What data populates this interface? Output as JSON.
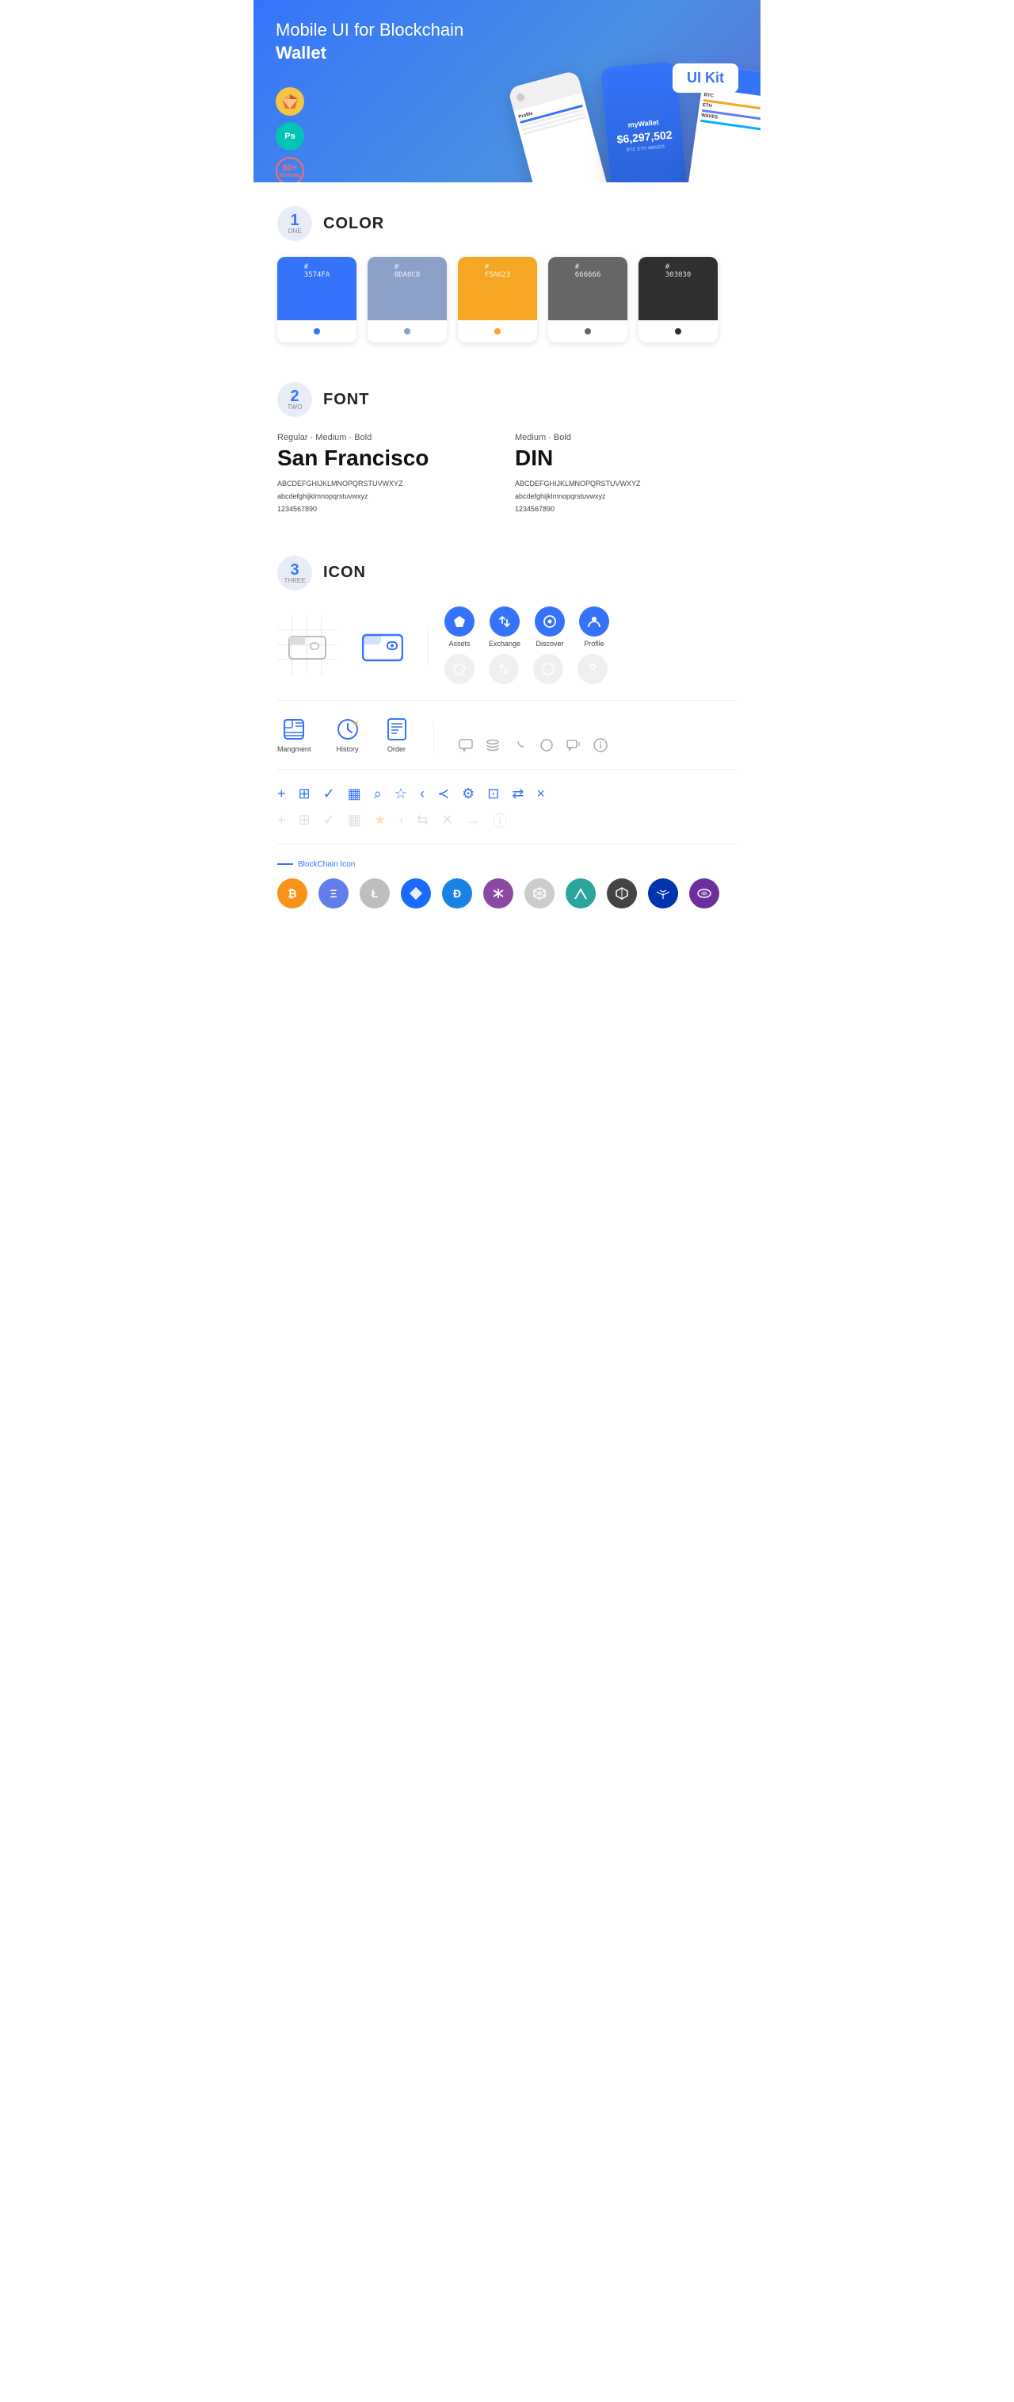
{
  "hero": {
    "title_regular": "Mobile UI for Blockchain ",
    "title_bold": "Wallet",
    "badge": "UI Kit",
    "badge_sketch": "◆",
    "badge_ps": "Ps",
    "screens_count": "60+",
    "screens_label": "Screens"
  },
  "sections": {
    "color": {
      "num": "1",
      "sub": "ONE",
      "label": "COLOR",
      "swatches": [
        {
          "hex": "#3574FA",
          "code": "#\n3574FA"
        },
        {
          "hex": "#8DA0C8",
          "code": "#\n8DA0C8"
        },
        {
          "hex": "#F5A623",
          "code": "#\nF5A623"
        },
        {
          "hex": "#666666",
          "code": "#\n666666"
        },
        {
          "hex": "#303030",
          "code": "#\n303030"
        }
      ]
    },
    "font": {
      "num": "2",
      "sub": "TWO",
      "label": "FONT",
      "left": {
        "style": "Regular · Medium · Bold",
        "name": "San Francisco",
        "upper": "ABCDEFGHIJKLMNOPQRSTUVWXYZ",
        "lower": "abcdefghijklmnopqrstuvwxyz",
        "nums": "1234567890"
      },
      "right": {
        "style": "Medium · Bold",
        "name": "DIN",
        "upper": "ABCDEFGHIJKLMNOPQRSTUVWXYZ",
        "lower": "abcdefghijklmnopqrstuvwxyz",
        "nums": "1234567890"
      }
    },
    "icon": {
      "num": "3",
      "sub": "THREE",
      "label": "ICON",
      "nav_items": [
        {
          "label": "Assets",
          "filled": true
        },
        {
          "label": "Exchange",
          "filled": true
        },
        {
          "label": "Discover",
          "filled": true
        },
        {
          "label": "Profile",
          "filled": true
        }
      ],
      "nav_ghost": [
        {
          "label": "",
          "filled": false
        },
        {
          "label": "",
          "filled": false
        },
        {
          "label": "",
          "filled": false
        },
        {
          "label": "",
          "filled": false
        }
      ],
      "bottom_icons": [
        {
          "label": "Mangment",
          "sym": "▣"
        },
        {
          "label": "History",
          "sym": "🕐"
        },
        {
          "label": "Order",
          "sym": "📋"
        }
      ],
      "tool_icons": [
        "+",
        "⊞",
        "✓",
        "⊞",
        "🔍",
        "☆",
        "<",
        "≺",
        "⚙",
        "⊡",
        "⇄",
        "×"
      ],
      "blockchain_label": "BlockChain Icon",
      "coins": [
        {
          "color": "#F7931A",
          "symbol": "₿"
        },
        {
          "color": "#627EEA",
          "symbol": "Ξ"
        },
        {
          "color": "#B5B5B5",
          "symbol": "Ł"
        },
        {
          "color": "#1A6AFF",
          "symbol": "◆"
        },
        {
          "color": "#1A82E2",
          "symbol": "Ð"
        },
        {
          "color": "#8C4799",
          "symbol": "Z"
        },
        {
          "color": "#BBBBBB",
          "symbol": "◈"
        },
        {
          "color": "#2CA4A0",
          "symbol": "▲"
        },
        {
          "color": "#333",
          "symbol": "◇"
        },
        {
          "color": "#0033AD",
          "symbol": "⬡"
        },
        {
          "color": "#6D2FA0",
          "symbol": "⊕"
        }
      ]
    }
  }
}
